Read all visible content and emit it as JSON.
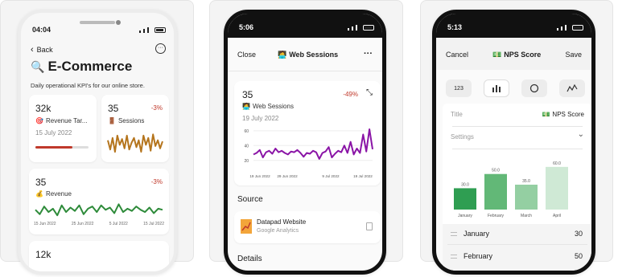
{
  "colors": {
    "red": "#c0392b",
    "brown": "#b5751d",
    "green": "#2e8b3a",
    "purple": "#8a14a6",
    "chart_green": "#2f9e52"
  },
  "p1": {
    "time": "04:04",
    "back": "Back",
    "title": "E-Commerce",
    "subtitle": "Daily operational KPI's for our online store.",
    "kpi1": {
      "value": "32k",
      "label": "Revenue Tar...",
      "date": "15 July 2022",
      "progress": 0.7
    },
    "kpi2": {
      "value": "35",
      "change": "-3%",
      "label": "Sessions"
    },
    "kpi3": {
      "value": "35",
      "change": "-3%",
      "label": "Revenue",
      "ticks": [
        "15 Jun 2022",
        "25 Jun 2022",
        "5 Jul 2022",
        "15 Jul 2022"
      ]
    },
    "kpi4": {
      "value": "12k"
    }
  },
  "p2": {
    "time": "5:06",
    "close": "Close",
    "title": "Web Sessions",
    "value": "35",
    "change": "-49%",
    "metric": "Web Sessions",
    "date": "19 July 2022",
    "yticks": [
      "60",
      "40",
      "20"
    ],
    "xticks": [
      "19 Jun 2022",
      "29 Jun 2022",
      "9 Jul 2022",
      "19 Jul 2022"
    ],
    "source_heading": "Source",
    "source_name": "Datapad Website",
    "source_sub": "Google Analytics",
    "details_heading": "Details"
  },
  "p3": {
    "time": "5:13",
    "cancel": "Cancel",
    "title": "NPS Score",
    "save": "Save",
    "tab_number": "123",
    "field_title_label": "Title",
    "field_title_value": "NPS Score",
    "settings_label": "Settings",
    "rows": [
      {
        "label": "January",
        "value": "30"
      },
      {
        "label": "February",
        "value": "50"
      }
    ]
  },
  "chart_data": [
    {
      "type": "bar",
      "categories": [
        "January",
        "February",
        "March",
        "April"
      ],
      "values": [
        30.0,
        50.0,
        35.0,
        60.0
      ],
      "value_labels": [
        "30.0",
        "50.0",
        "35.0",
        "60.0"
      ],
      "ylim": [
        0,
        70
      ]
    },
    {
      "type": "line",
      "yticks": [
        20,
        40,
        60
      ],
      "xticks": [
        "19 Jun 2022",
        "29 Jun 2022",
        "9 Jul 2022",
        "19 Jul 2022"
      ],
      "values": [
        28,
        30,
        34,
        24,
        31,
        33,
        29,
        36,
        31,
        33,
        30,
        28,
        32,
        31,
        34,
        30,
        25,
        30,
        29,
        33,
        31,
        22,
        30,
        32,
        38,
        24,
        29,
        33,
        31,
        40,
        30,
        45,
        28,
        36,
        30,
        55,
        32,
        62,
        35
      ]
    },
    {
      "type": "line",
      "values": [
        22,
        14,
        24,
        12,
        26,
        18,
        23,
        15,
        26,
        14,
        20,
        24,
        16,
        22,
        12,
        26,
        18,
        24,
        13,
        27,
        17,
        22,
        15,
        21
      ]
    },
    {
      "type": "line",
      "xticks": [
        "15 Jun 2022",
        "25 Jun 2022",
        "5 Jul 2022",
        "15 Jul 2022"
      ],
      "values": [
        40,
        36,
        43,
        38,
        41,
        35,
        44,
        38,
        42,
        39,
        44,
        36,
        41,
        43,
        38,
        44,
        40,
        42,
        37,
        45,
        38,
        41,
        39,
        43,
        40,
        38,
        42,
        37,
        41,
        40
      ]
    },
    {
      "type": "bar",
      "categories": [
        "progress"
      ],
      "values": [
        0.7
      ]
    }
  ]
}
